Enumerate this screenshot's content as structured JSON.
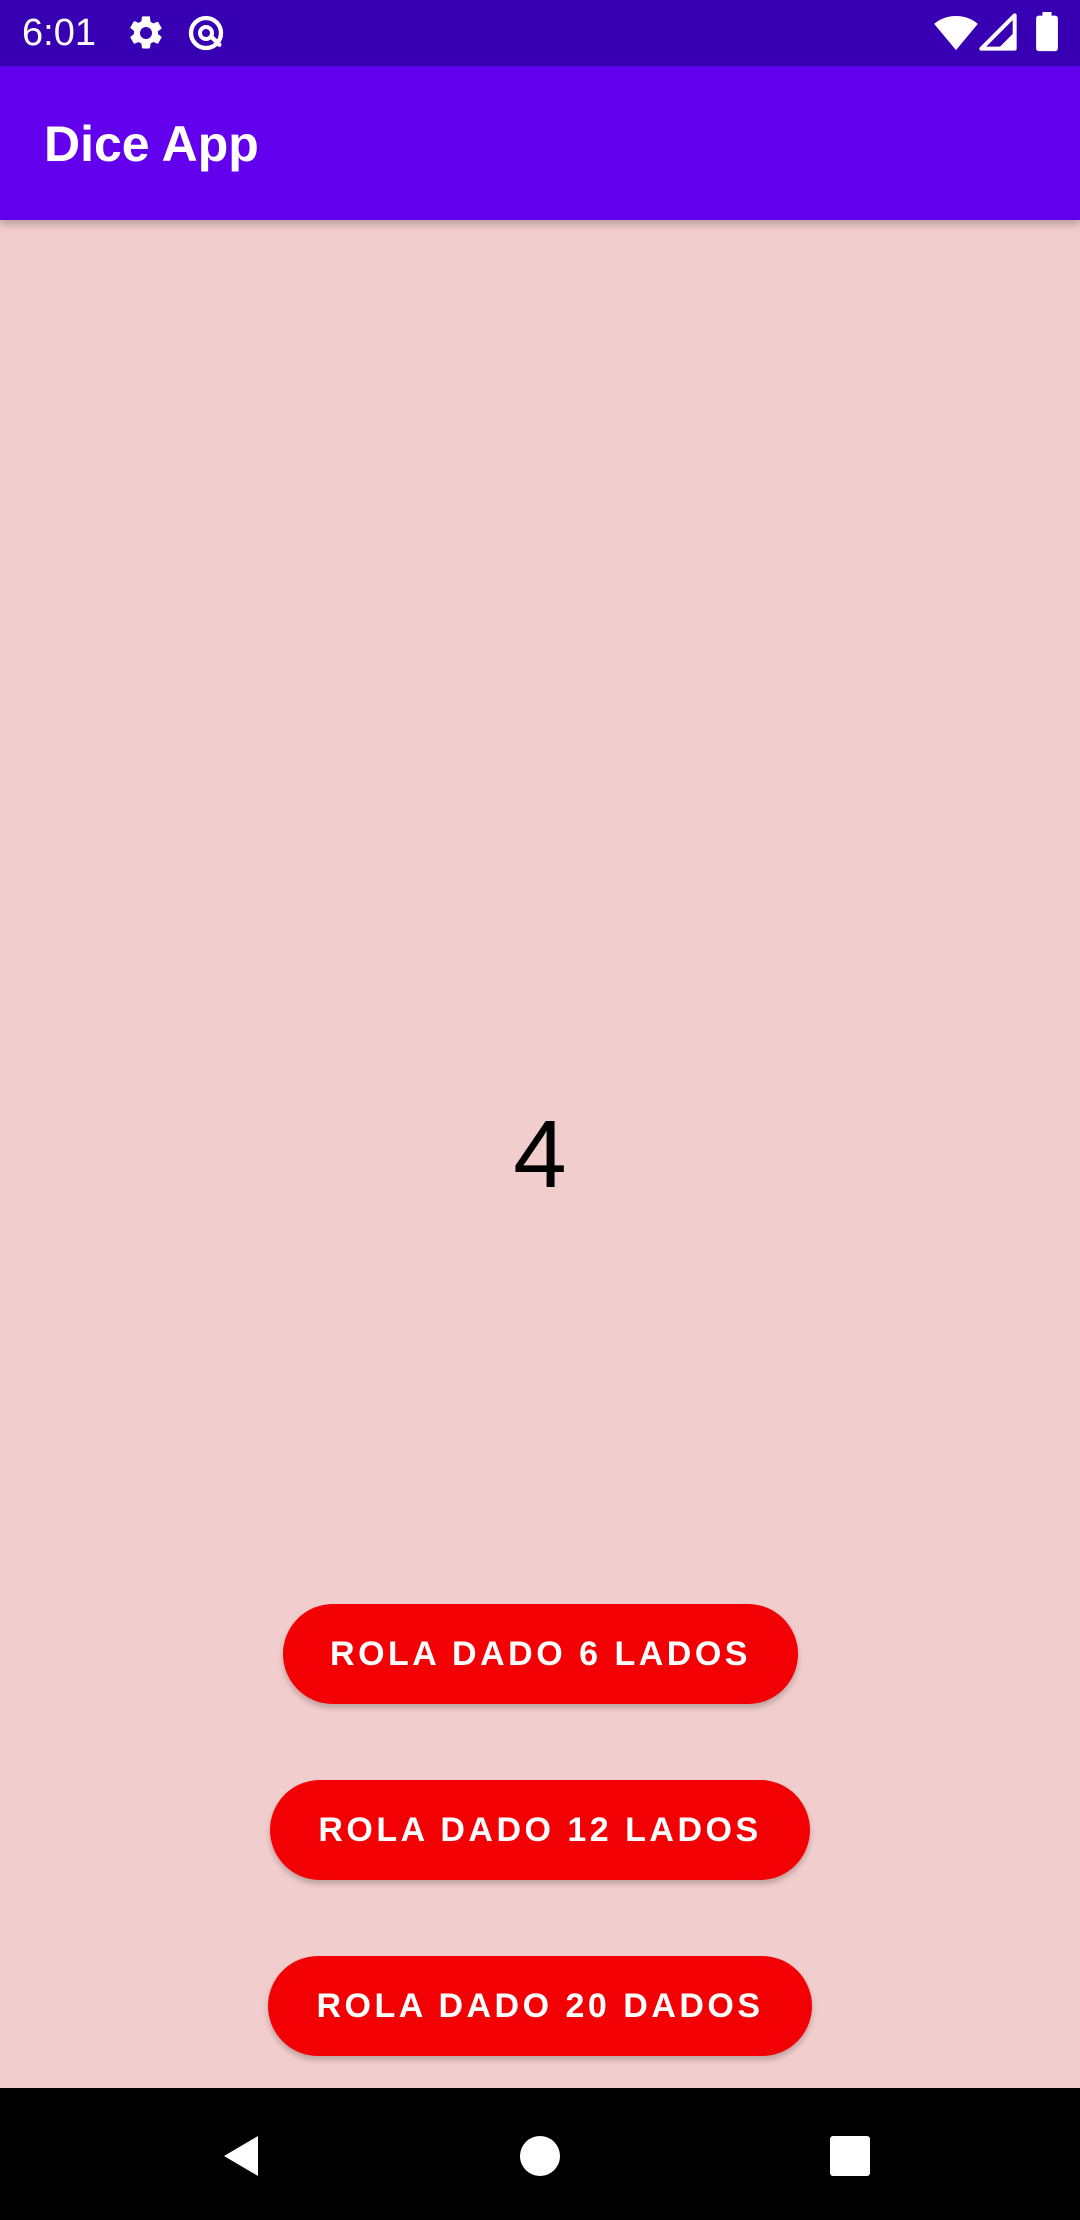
{
  "status_bar": {
    "time": "6:01",
    "icons": [
      "gear-icon",
      "at-sign-icon",
      "wifi-icon",
      "signal-icon",
      "battery-icon"
    ]
  },
  "app_bar": {
    "title": "Dice App"
  },
  "main": {
    "result": "4",
    "buttons": [
      {
        "label": "ROLA DADO 6 LADOS"
      },
      {
        "label": "ROLA DADO 12 LADOS"
      },
      {
        "label": "ROLA DADO 20 DADOS"
      }
    ]
  },
  "nav_bar": {
    "icons": [
      "back-icon",
      "home-icon",
      "recents-icon"
    ]
  },
  "colors": {
    "status_bar": "#3700b3",
    "app_bar": "#6200ee",
    "background": "#f2cdcd",
    "button": "#f20004",
    "nav_bar": "#000000"
  }
}
